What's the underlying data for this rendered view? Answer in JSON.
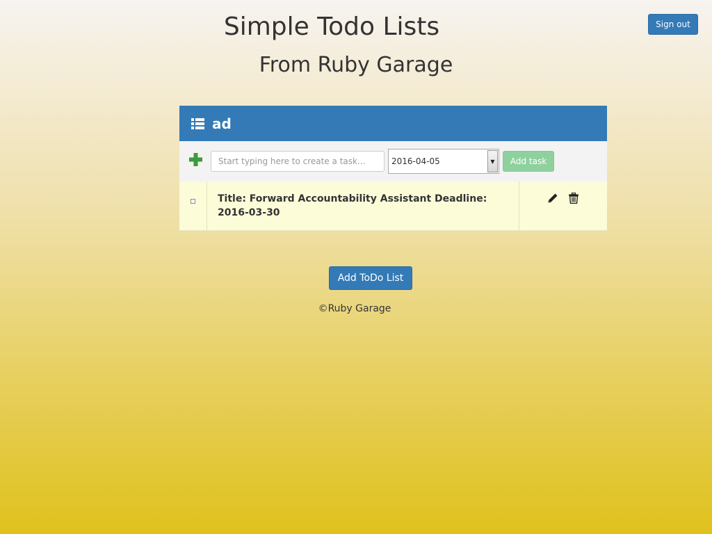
{
  "header": {
    "sign_out_label": "Sign out",
    "title": "Simple Todo Lists",
    "subtitle": "From Ruby Garage"
  },
  "todo_list": {
    "name": "ad",
    "icon": "list-icon",
    "add_icon": "plus-icon",
    "task_input_placeholder": "Start typing here to create a task...",
    "date_value": "2016-04-05",
    "add_task_label": "Add task",
    "tasks": [
      {
        "text": "Title: Forward Accountability Assistant Deadline: 2016-03-30",
        "done": false
      }
    ]
  },
  "add_list_label": "Add ToDo List",
  "footer": "©Ruby Garage",
  "colors": {
    "primary": "#337ab7",
    "add_task_disabled": "#8fd19e",
    "plus_green": "#3c9b3c",
    "task_row_bg": "#fcfcd9"
  }
}
